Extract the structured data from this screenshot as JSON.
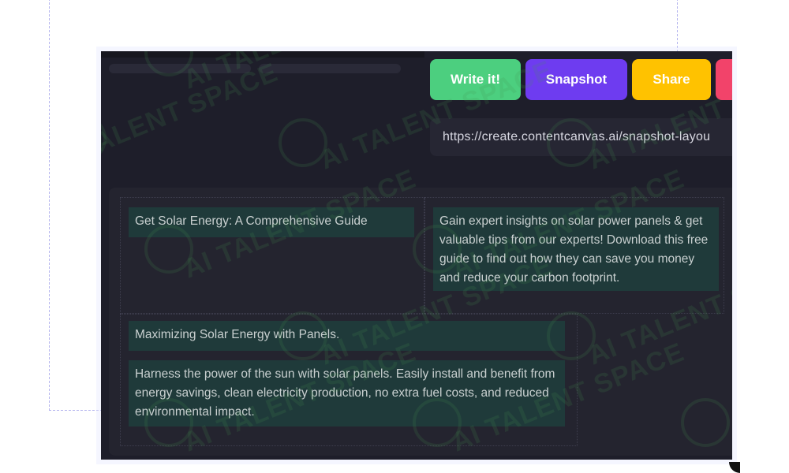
{
  "toolbar": {
    "write_label": "Write it!",
    "snapshot_label": "Snapshot",
    "share_label": "Share",
    "colors": {
      "write": "#4ccf7f",
      "snapshot": "#6e3cf0",
      "share": "#ffc200",
      "extra": "#f2436a"
    }
  },
  "url_field": {
    "value": "https://create.contentcanvas.ai/snapshot-layou"
  },
  "canvas": {
    "blocks": [
      {
        "text": "Get Solar Energy: A Comprehensive Guide"
      },
      {
        "text": "Gain expert insights on solar power panels & get valuable tips from our experts! Download this free guide to find out how they can save you money and reduce your carbon footprint."
      },
      {
        "text": "Maximizing Solar Energy with Panels."
      },
      {
        "text": "Harness the power of the sun with solar panels. Easily install and benefit from energy savings, clean electricity production, no extra fuel costs, and reduced environmental impact."
      }
    ]
  },
  "watermark": {
    "text": "AI TALENT SPACE",
    "icon": "brain-icon"
  }
}
